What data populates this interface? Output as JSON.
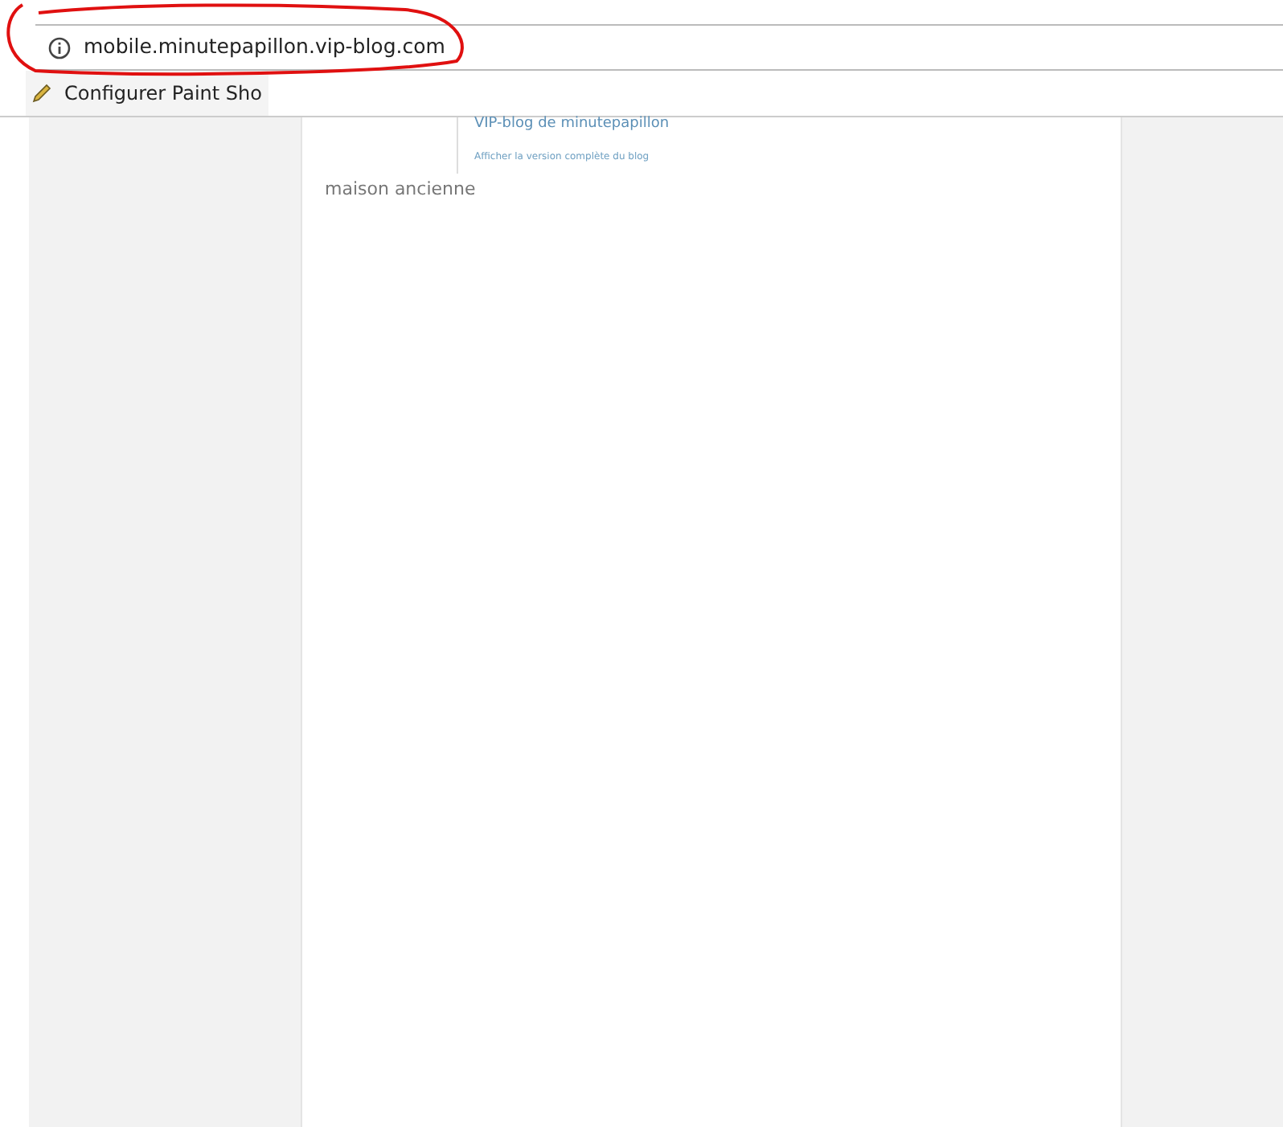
{
  "address_bar": {
    "url": "mobile.minutepapillon.vip-blog.com"
  },
  "bookmarks": [
    {
      "label": "Configurer Paint Sho"
    }
  ],
  "blog_header": {
    "title": "VIP-blog de minutepapillon",
    "link": "Afficher la version complète du blog"
  },
  "post": {
    "title": "maison ancienne"
  }
}
